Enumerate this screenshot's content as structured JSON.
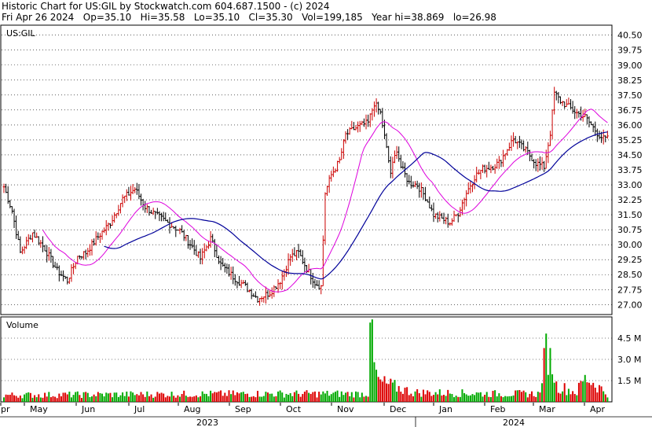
{
  "header": {
    "line1": "Historic Chart for US:GIL by Stockwatch.com 604.687.1500 - (c) 2024",
    "line2": "Fri Apr 26 2024   Op=35.10   Hi=35.58   Lo=35.10   Cl=35.30   Vol=199,185   Year hi=38.869   lo=26.98"
  },
  "chart_data": {
    "type": "bar",
    "symbol_label": "US:GIL",
    "price_axis": {
      "ticks": [
        "40.50",
        "39.75",
        "39.00",
        "38.25",
        "37.50",
        "36.75",
        "36.00",
        "35.25",
        "34.50",
        "33.75",
        "33.00",
        "32.25",
        "31.50",
        "30.75",
        "30.00",
        "29.25",
        "28.50",
        "27.75",
        "27.00"
      ]
    },
    "volume_panel": {
      "label": "Volume",
      "ticks": [
        "4.5 M",
        "3.0 M",
        "1.5 M"
      ]
    },
    "x_labels": [
      "pr",
      "May",
      "Jun",
      "Jul",
      "Aug",
      "Sep",
      "Oct",
      "Nov",
      "Dec",
      "Jan",
      "Feb",
      "Mar",
      "Apr"
    ],
    "year_labels": [
      "2023",
      "2024"
    ],
    "price_anchors": [
      [
        0,
        32.9
      ],
      [
        4,
        31.7
      ],
      [
        8,
        29.6
      ],
      [
        14,
        30.6
      ],
      [
        20,
        29.8
      ],
      [
        26,
        28.7
      ],
      [
        31,
        28.2
      ],
      [
        36,
        29.4
      ],
      [
        40,
        29.6
      ],
      [
        46,
        30.4
      ],
      [
        52,
        31.1
      ],
      [
        58,
        32.3
      ],
      [
        64,
        32.8
      ],
      [
        69,
        31.9
      ],
      [
        74,
        31.5
      ],
      [
        80,
        31.1
      ],
      [
        86,
        30.7
      ],
      [
        92,
        29.9
      ],
      [
        96,
        29.3
      ],
      [
        101,
        30.3
      ],
      [
        106,
        29.0
      ],
      [
        112,
        28.4
      ],
      [
        118,
        27.9
      ],
      [
        124,
        27.3
      ],
      [
        130,
        27.6
      ],
      [
        135,
        28.2
      ],
      [
        140,
        29.4
      ],
      [
        144,
        29.6
      ],
      [
        148,
        28.8
      ],
      [
        152,
        28.1
      ],
      [
        155,
        27.9
      ],
      [
        157,
        32.6
      ],
      [
        160,
        33.5
      ],
      [
        164,
        34.2
      ],
      [
        167,
        35.5
      ],
      [
        171,
        35.8
      ],
      [
        175,
        36.0
      ],
      [
        178,
        36.1
      ],
      [
        181,
        37.1
      ],
      [
        184,
        36.6
      ],
      [
        186,
        35.4
      ],
      [
        189,
        33.6
      ],
      [
        192,
        34.8
      ],
      [
        194,
        33.9
      ],
      [
        198,
        33.1
      ],
      [
        202,
        33.0
      ],
      [
        206,
        32.4
      ],
      [
        210,
        31.5
      ],
      [
        214,
        31.3
      ],
      [
        218,
        31.1
      ],
      [
        222,
        31.6
      ],
      [
        226,
        32.6
      ],
      [
        230,
        33.4
      ],
      [
        234,
        33.8
      ],
      [
        238,
        33.9
      ],
      [
        242,
        34.1
      ],
      [
        246,
        34.8
      ],
      [
        249,
        35.3
      ],
      [
        252,
        35.0
      ],
      [
        256,
        34.6
      ],
      [
        260,
        34.1
      ],
      [
        264,
        33.9
      ],
      [
        267,
        35.6
      ],
      [
        269,
        37.6
      ],
      [
        272,
        37.2
      ],
      [
        276,
        36.9
      ],
      [
        280,
        36.6
      ],
      [
        284,
        36.4
      ],
      [
        287,
        36.0
      ],
      [
        290,
        35.6
      ],
      [
        293,
        35.3
      ],
      [
        295,
        35.3
      ]
    ],
    "volume_anchors": [
      [
        0,
        0.5
      ],
      [
        60,
        0.55
      ],
      [
        120,
        0.6
      ],
      [
        178,
        0.6
      ],
      [
        179,
        5.6
      ],
      [
        181,
        2.8
      ],
      [
        183,
        1.5
      ],
      [
        200,
        0.7
      ],
      [
        240,
        0.6
      ],
      [
        262,
        0.6
      ],
      [
        264,
        3.8
      ],
      [
        267,
        3.8
      ],
      [
        270,
        1.2
      ],
      [
        280,
        0.7
      ],
      [
        284,
        1.9
      ],
      [
        295,
        0.6
      ]
    ],
    "sma_short_label": "",
    "sma_long_label": "",
    "colors": {
      "bar_up": "#cc0000",
      "bar_down": "#000000",
      "sma_short": "#dd00dd",
      "sma_long": "#000099",
      "vol_up": "#00aa00",
      "vol_down": "#dd0000",
      "grid": "#000000"
    }
  }
}
